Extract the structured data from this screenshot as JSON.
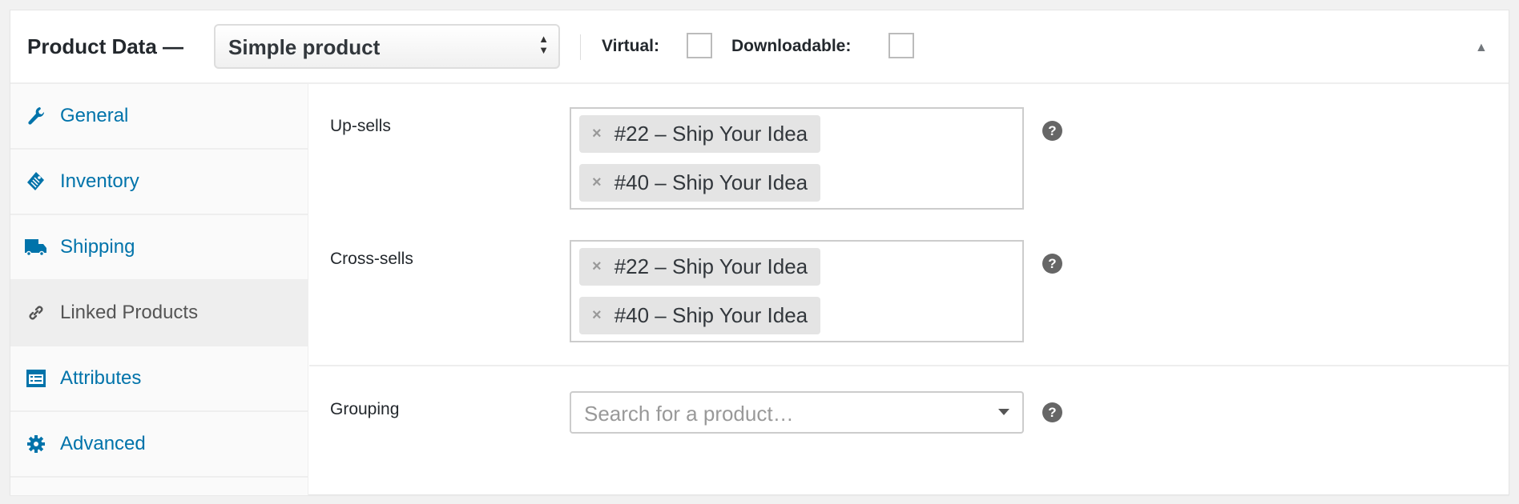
{
  "header": {
    "title": "Product Data —",
    "product_type": "Simple product",
    "virtual_label": "Virtual:",
    "virtual_checked": false,
    "downloadable_label": "Downloadable:",
    "downloadable_checked": false
  },
  "sidebar": {
    "items": [
      {
        "label": "General",
        "icon": "wrench-icon",
        "active": false
      },
      {
        "label": "Inventory",
        "icon": "tag-icon",
        "active": false
      },
      {
        "label": "Shipping",
        "icon": "truck-icon",
        "active": false
      },
      {
        "label": "Linked Products",
        "icon": "link-icon",
        "active": true
      },
      {
        "label": "Attributes",
        "icon": "list-icon",
        "active": false
      },
      {
        "label": "Advanced",
        "icon": "gear-icon",
        "active": false
      }
    ]
  },
  "fields": {
    "upsells": {
      "label": "Up-sells",
      "items": [
        "#22 – Ship Your Idea",
        "#40 – Ship Your Idea"
      ],
      "help": "?"
    },
    "crosssells": {
      "label": "Cross-sells",
      "items": [
        "#22 – Ship Your Idea",
        "#40 – Ship Your Idea"
      ],
      "help": "?"
    },
    "grouping": {
      "label": "Grouping",
      "placeholder": "Search for a product…",
      "help": "?"
    }
  },
  "colors": {
    "link": "#0073aa",
    "active_bg": "#eeeeee",
    "chip_bg": "#e4e4e4"
  }
}
